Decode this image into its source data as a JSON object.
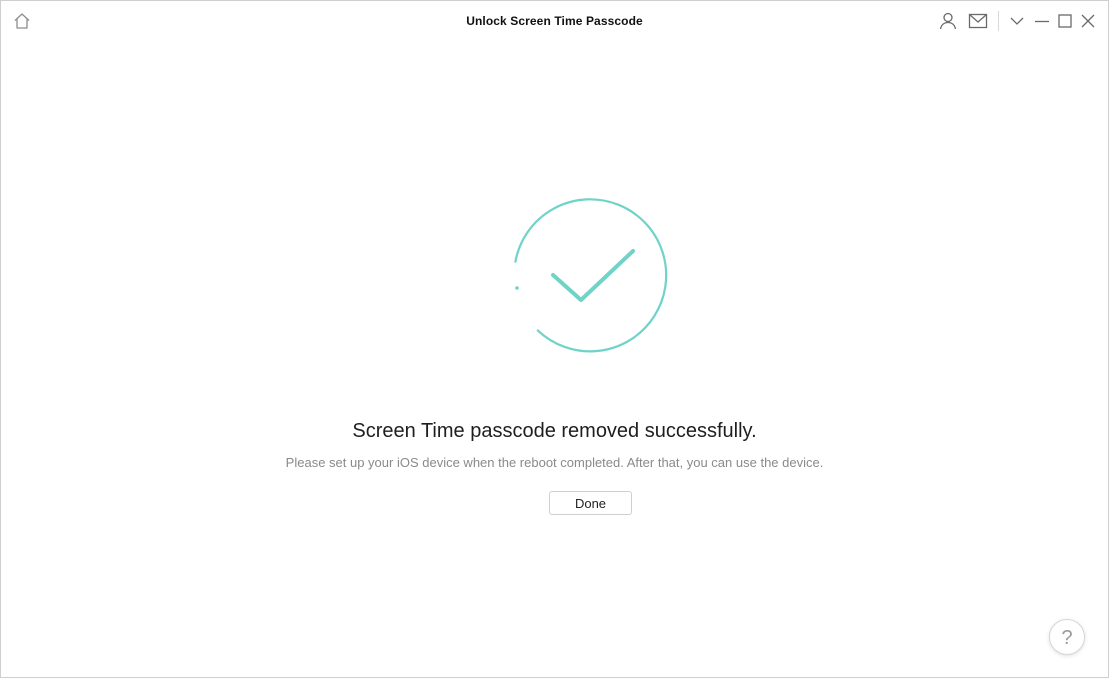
{
  "window": {
    "title": "Unlock Screen Time Passcode"
  },
  "titlebar": {
    "left_icons": [
      "home-icon"
    ],
    "right_icons": [
      "account-icon",
      "mail-icon",
      "chevron-down-icon",
      "minimize-icon",
      "maximize-icon",
      "close-icon"
    ]
  },
  "main": {
    "status_icon": "check-circle-icon",
    "headline": "Screen Time passcode removed successfully.",
    "message": "Please set up your iOS device when the reboot completed. After that, you can use the device.",
    "done_label": "Done"
  },
  "help": {
    "label": "?"
  },
  "colors": {
    "accent": "#6fd3c8",
    "text_primary": "#1e1e1e",
    "text_secondary": "#8a8a8a",
    "border": "#cfcfcf"
  }
}
